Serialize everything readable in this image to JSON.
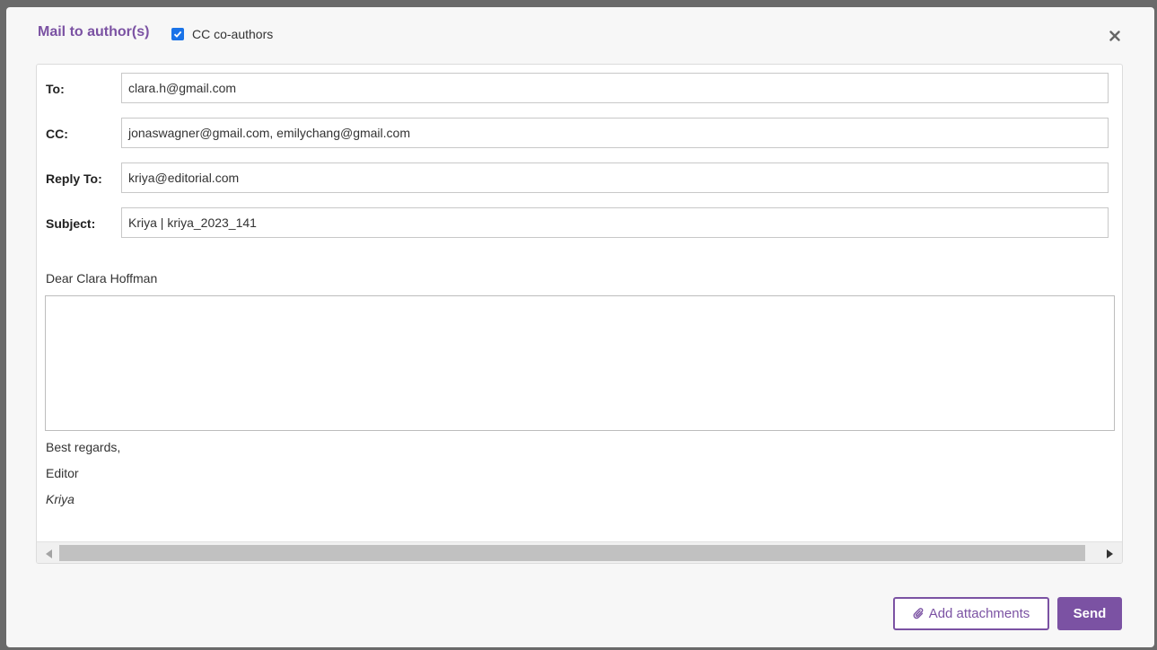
{
  "header": {
    "title": "Mail to author(s)",
    "cc_coauthors": {
      "label": "CC co-authors",
      "checked": true
    }
  },
  "fields": {
    "to": {
      "label": "To:",
      "value": "clara.h@gmail.com"
    },
    "cc": {
      "label": "CC:",
      "value": "jonaswagner@gmail.com, emilychang@gmail.com"
    },
    "reply_to": {
      "label": "Reply To:",
      "value": "kriya@editorial.com"
    },
    "subject": {
      "label": "Subject:",
      "value": "Kriya | kriya_2023_141"
    }
  },
  "body": {
    "greeting": "Dear Clara Hoffman",
    "message": "",
    "closing": "Best regards,",
    "role": "Editor",
    "signature": "Kriya"
  },
  "footer": {
    "attach_label": "Add attachments",
    "send_label": "Send"
  },
  "colors": {
    "accent": "#7b52a3",
    "checkbox": "#1a73e8"
  }
}
